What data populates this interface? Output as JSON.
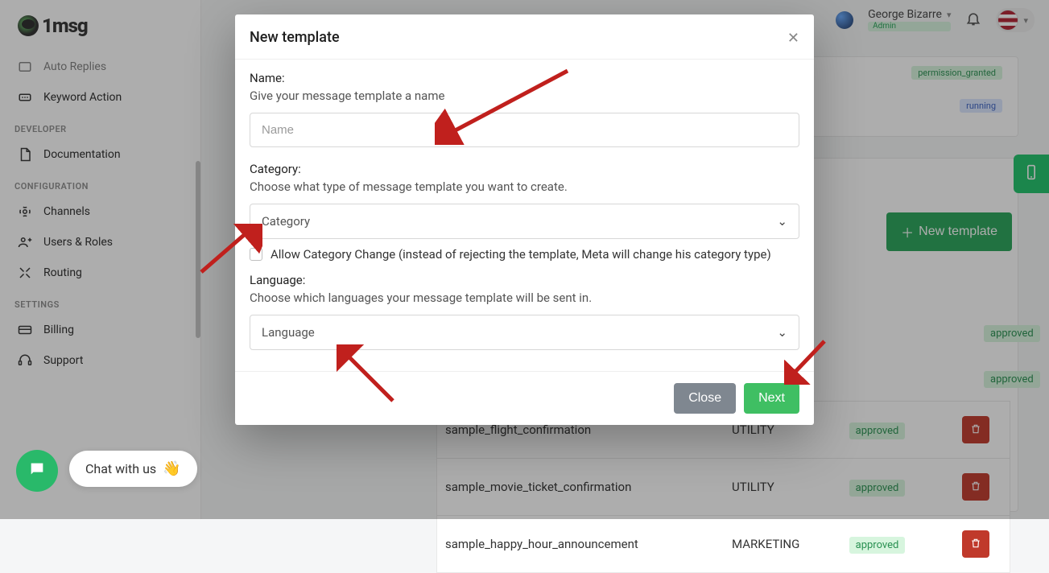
{
  "brand": {
    "name": "1msg"
  },
  "header": {
    "user": {
      "name": "George Bizarre",
      "role": "Admin"
    }
  },
  "sidebar": {
    "dev_header": "DEVELOPER",
    "config_header": "CONFIGURATION",
    "settings_header": "SETTINGS",
    "items": {
      "auto_replies": "Auto Replies",
      "keyword_action": "Keyword Action",
      "documentation": "Documentation",
      "channels": "Channels",
      "users_roles": "Users & Roles",
      "routing": "Routing",
      "billing": "Billing",
      "support": "Support"
    }
  },
  "chat": {
    "cta": "Chat with us"
  },
  "status_chips": {
    "permission": "permission_granted",
    "running": "running"
  },
  "actions": {
    "new_template": "New template"
  },
  "table": {
    "rows": [
      {
        "name": "sample_flight_confirmation",
        "category": "UTILITY",
        "status": "approved"
      },
      {
        "name": "sample_movie_ticket_confirmation",
        "category": "UTILITY",
        "status": "approved"
      },
      {
        "name": "sample_happy_hour_announcement",
        "category": "MARKETING",
        "status": "approved"
      }
    ],
    "visible_status_above": "approved"
  },
  "modal": {
    "title": "New template",
    "name_label": "Name:",
    "name_desc": "Give your message template a name",
    "name_placeholder": "Name",
    "category_label": "Category:",
    "category_desc": "Choose what type of message template you want to create.",
    "category_placeholder": "Category",
    "allow_change": "Allow Category Change (instead of rejecting the template, Meta will change his category type)",
    "language_label": "Language:",
    "language_desc": "Choose which languages your message template will be sent in.",
    "language_placeholder": "Language",
    "close_btn": "Close",
    "next_btn": "Next"
  }
}
